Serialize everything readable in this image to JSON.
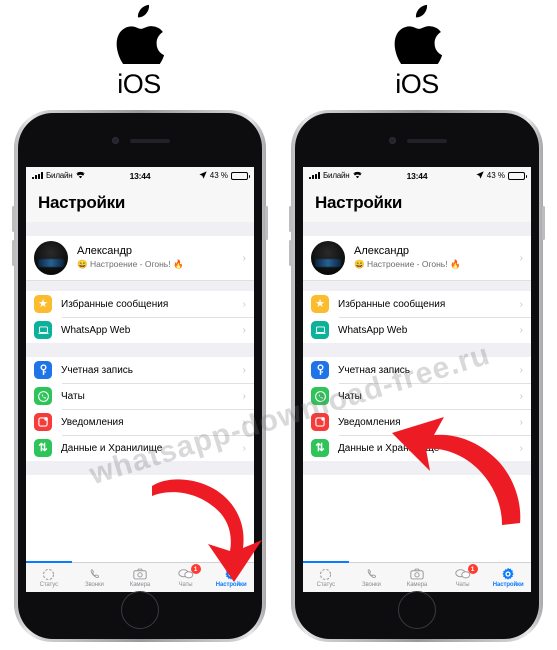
{
  "brand": {
    "logo_icon": "apple-logo-icon",
    "label": "iOS"
  },
  "watermark": "whatsapp-download-free.ru",
  "phone": {
    "status_bar": {
      "carrier": "Билайн",
      "wifi_icon": "wifi-icon",
      "time": "13:44",
      "location_icon": "location-arrow-icon",
      "battery_percent": "43 %",
      "battery_icon": "battery-icon"
    },
    "nav_title": "Настройки",
    "profile": {
      "avatar_icon": "avatar",
      "name": "Александр",
      "status": "😄 Настроение - Огонь! 🔥",
      "chevron": "›"
    },
    "groups": [
      {
        "rows": [
          {
            "icon": "star-icon",
            "color": "#fcbc2e",
            "label": "Избранные сообщения",
            "chevron": "›"
          },
          {
            "icon": "laptop-icon",
            "color": "#0cb19a",
            "label": "WhatsApp Web",
            "chevron": "›"
          }
        ]
      },
      {
        "rows": [
          {
            "icon": "key-icon",
            "color": "#1f74e8",
            "label": "Учетная запись",
            "chevron": "›"
          },
          {
            "icon": "whatsapp-icon",
            "color": "#2fc45a",
            "label": "Чаты",
            "chevron": "›"
          },
          {
            "icon": "bell-icon",
            "color": "#f63b3b",
            "label": "Уведомления",
            "chevron": "›"
          },
          {
            "icon": "data-arrows-icon",
            "color": "#2fc45a",
            "label": "Данные и Хранилище",
            "chevron": "›"
          }
        ]
      }
    ],
    "tabs": [
      {
        "icon": "status-ring-icon",
        "label": "Статус",
        "active": false,
        "badge": ""
      },
      {
        "icon": "phone-icon",
        "label": "Звонки",
        "active": false,
        "badge": ""
      },
      {
        "icon": "camera-icon",
        "label": "Камера",
        "active": false,
        "badge": ""
      },
      {
        "icon": "chats-bubble-icon",
        "label": "Чаты",
        "active": false,
        "badge": "1"
      },
      {
        "icon": "gear-icon",
        "label": "Настройки",
        "active": true,
        "badge": ""
      }
    ]
  },
  "annotations": {
    "left_arrow": {
      "icon": "red-curved-arrow-down-right",
      "color": "#ed1c24"
    },
    "right_arrow": {
      "icon": "red-curved-arrow-up-left",
      "color": "#ed1c24"
    }
  }
}
